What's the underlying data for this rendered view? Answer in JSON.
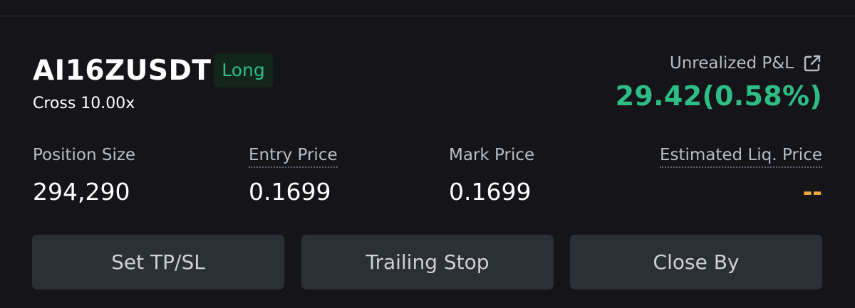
{
  "position": {
    "symbol": "AI16ZUSDT",
    "side": "Long",
    "margin_mode": "Cross 10.00x"
  },
  "pnl": {
    "label": "Unrealized P&L",
    "share_icon": "external-link-icon",
    "value": "29.42(0.58%)"
  },
  "stats": {
    "position_size": {
      "label": "Position Size",
      "value": "294,290"
    },
    "entry_price": {
      "label": "Entry Price",
      "value": "0.1699"
    },
    "mark_price": {
      "label": "Mark Price",
      "value": "0.1699"
    },
    "liq_price": {
      "label": "Estimated Liq. Price",
      "value": "--"
    }
  },
  "actions": {
    "tpsl": "Set TP/SL",
    "trailing_stop": "Trailing Stop",
    "close_by": "Close By"
  },
  "colors": {
    "background": "#151519",
    "positive": "#2ebd85",
    "liq_warning": "#f0a53a",
    "button_bg": "#2b2f36",
    "label": "#b7bdc6"
  }
}
